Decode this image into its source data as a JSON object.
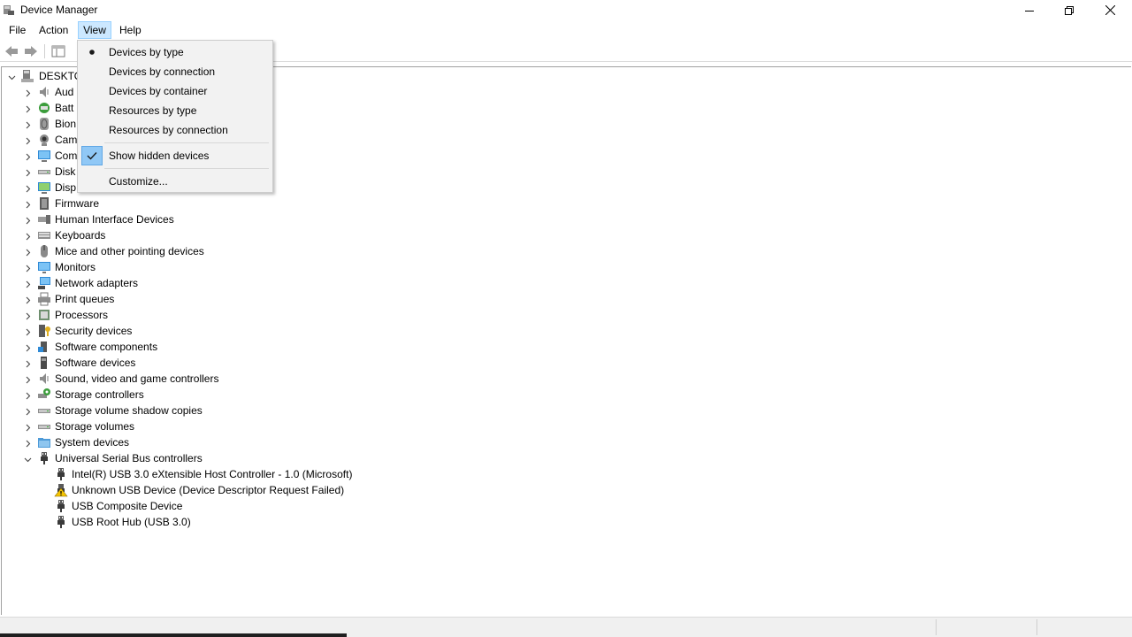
{
  "window": {
    "title": "Device Manager"
  },
  "menubar": {
    "file": "File",
    "action": "Action",
    "view": "View",
    "help": "Help"
  },
  "view_menu": {
    "items": [
      {
        "label": "Devices by type",
        "mark": "radio"
      },
      {
        "label": "Devices by connection",
        "mark": "none"
      },
      {
        "label": "Devices by container",
        "mark": "none"
      },
      {
        "label": "Resources by type",
        "mark": "none"
      },
      {
        "label": "Resources by connection",
        "mark": "none"
      },
      {
        "label": "Show hidden devices",
        "mark": "check"
      },
      {
        "label": "Customize...",
        "mark": "none"
      }
    ]
  },
  "tree": {
    "root": "DESKTO",
    "categories": [
      {
        "label": "Aud",
        "icon": "speaker-icon"
      },
      {
        "label": "Batt",
        "icon": "battery-icon"
      },
      {
        "label": "Bion",
        "icon": "fingerprint-icon"
      },
      {
        "label": "Cam",
        "icon": "camera-icon"
      },
      {
        "label": "Com",
        "icon": "computer-icon"
      },
      {
        "label": "Disk",
        "icon": "disk-drive-icon"
      },
      {
        "label": "Disp",
        "icon": "display-adapter-icon"
      },
      {
        "label": "Firmware",
        "icon": "firmware-icon"
      },
      {
        "label": "Human Interface Devices",
        "icon": "hid-icon"
      },
      {
        "label": "Keyboards",
        "icon": "keyboard-icon"
      },
      {
        "label": "Mice and other pointing devices",
        "icon": "mouse-icon"
      },
      {
        "label": "Monitors",
        "icon": "monitor-icon"
      },
      {
        "label": "Network adapters",
        "icon": "network-icon"
      },
      {
        "label": "Print queues",
        "icon": "printer-icon"
      },
      {
        "label": "Processors",
        "icon": "processor-icon"
      },
      {
        "label": "Security devices",
        "icon": "security-key-icon"
      },
      {
        "label": "Software components",
        "icon": "software-component-icon"
      },
      {
        "label": "Software devices",
        "icon": "software-device-icon"
      },
      {
        "label": "Sound, video and game controllers",
        "icon": "speaker-icon"
      },
      {
        "label": "Storage controllers",
        "icon": "storage-controller-icon"
      },
      {
        "label": "Storage volume shadow copies",
        "icon": "disk-drive-icon"
      },
      {
        "label": "Storage volumes",
        "icon": "disk-drive-icon"
      },
      {
        "label": "System devices",
        "icon": "system-folder-icon"
      },
      {
        "label": "Universal Serial Bus controllers",
        "icon": "usb-icon",
        "expanded": true
      }
    ],
    "usb_children": [
      {
        "label": "Intel(R) USB 3.0 eXtensible Host Controller - 1.0 (Microsoft)",
        "icon": "usb-icon"
      },
      {
        "label": "Unknown USB Device (Device Descriptor Request Failed)",
        "icon": "warning-usb-icon"
      },
      {
        "label": "USB Composite Device",
        "icon": "usb-icon"
      },
      {
        "label": "USB Root Hub (USB 3.0)",
        "icon": "usb-icon"
      }
    ]
  },
  "colors": {
    "menu_highlight": "#cce8ff",
    "check_bg": "#90c8f6",
    "warning": "#f5c400"
  }
}
